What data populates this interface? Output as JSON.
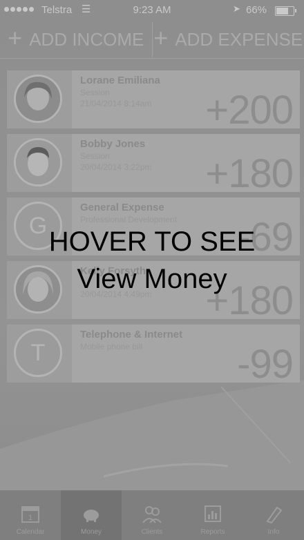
{
  "status_bar": {
    "carrier": "Telstra",
    "time": "9:23 AM",
    "battery": "66%"
  },
  "actions": {
    "add_income": "ADD INCOME",
    "add_expense": "ADD EXPENSE"
  },
  "entries": [
    {
      "name": "Lorane Emiliana",
      "category": "Session",
      "date": "21/04/2014 8:14am",
      "amount": "+200",
      "avatar": "photo"
    },
    {
      "name": "Bobby Jones",
      "category": "Session",
      "date": "20/04/2014 3:22pm",
      "amount": "+180",
      "avatar": "photo"
    },
    {
      "name": "General Expense",
      "category": "Professional Development",
      "date": "",
      "amount": "-69",
      "avatar": "G"
    },
    {
      "name": "Kelly Forsyth",
      "category": "",
      "date": "20/04/2014 4:49pm",
      "amount": "+180",
      "avatar": "photo"
    },
    {
      "name": "Telephone & Internet",
      "category": "Mobile phone bill",
      "date": "",
      "amount": "-99",
      "avatar": "T"
    }
  ],
  "overlay": {
    "line1": "HOVER TO SEE",
    "line2": "View Money"
  },
  "tabs": [
    {
      "label": "Calendar",
      "icon": "calendar-icon"
    },
    {
      "label": "Money",
      "icon": "piggy-bank-icon"
    },
    {
      "label": "Clients",
      "icon": "clients-icon"
    },
    {
      "label": "Reports",
      "icon": "reports-icon"
    },
    {
      "label": "Info",
      "icon": "info-icon"
    }
  ]
}
